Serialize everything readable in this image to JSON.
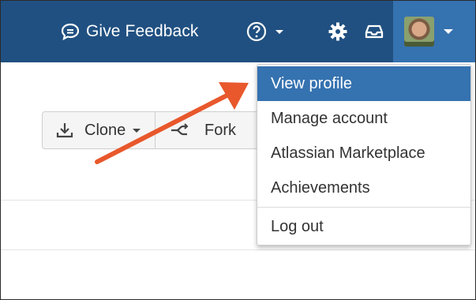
{
  "header": {
    "feedback_label": "Give Feedback",
    "help_icon": "question-circle-icon",
    "settings_icon": "gear-icon",
    "inbox_icon": "inbox-icon",
    "avatar_icon": "user-avatar"
  },
  "toolbar": {
    "clone_label": "Clone",
    "fork_label": "Fork"
  },
  "profile_menu": {
    "items": [
      {
        "label": "View profile",
        "state": "highlighted"
      },
      {
        "label": "Manage account"
      },
      {
        "label": "Atlassian Marketplace"
      },
      {
        "label": "Achievements"
      }
    ],
    "logout_label": "Log out"
  },
  "colors": {
    "header_bg": "#205081",
    "highlight": "#3572b0",
    "annotation_arrow": "#e8582c"
  }
}
